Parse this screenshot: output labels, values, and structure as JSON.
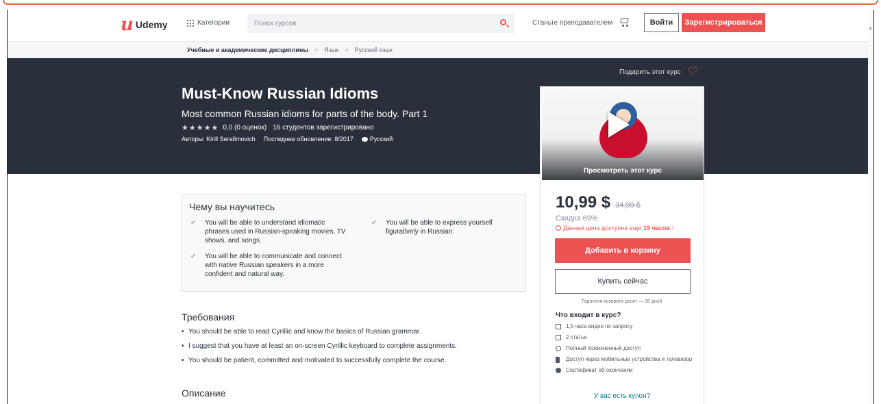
{
  "header": {
    "logo_text": "Udemy",
    "categories_label": "Категории",
    "search_placeholder": "Поиск курсов",
    "teach_label": "Станьте преподавателем",
    "login_label": "Войти",
    "signup_label": "Зарегистрироваться"
  },
  "breadcrumb": {
    "items": [
      "Учебные и академические дисциплины",
      "Язык",
      "Русский язык"
    ],
    "separator": ">"
  },
  "hero": {
    "gift_label": "Подарить этот курс",
    "title": "Must-Know Russian Idioms",
    "subtitle": "Most common Russian idioms for parts of the body. Part 1",
    "stars": "★★★★★",
    "rating_text": "0,0 (0 оценок)",
    "students_text": "16 студентов зарегистрировано",
    "authors_text": "Авторы: Kirill Serafimovich",
    "updated_text": "Последнее обновление: 8/2017",
    "language": "Русский"
  },
  "sidebar": {
    "preview_label": "Просмотреть этот курс",
    "price_now": "10,99 $",
    "price_old": "34,99 $",
    "discount": "Скидка 69%",
    "timer_prefix": "Данная цена доступна еще",
    "timer_value": "19 часов",
    "timer_suffix": "!",
    "add_to_cart_label": "Добавить в корзину",
    "buy_now_label": "Купить сейчас",
    "guarantee": "Гарантия возврата денег — 30 дней",
    "includes_title": "Что входит в курс?",
    "includes": [
      "1,5 часа видео по запросу",
      "2 статьи",
      "Полный пожизненный доступ",
      "Доступ через мобильные устройства и телевизор",
      "Сертификат об окончании"
    ],
    "coupon_label": "У вас есть купон?"
  },
  "learn": {
    "title": "Чему вы научитесь",
    "items": [
      "You will be able to understand idiomatic phrases used in Russian-speaking movies, TV shows, and songs.",
      "You will be able to express yourself figuratively in Russian.",
      "You will be able to communicate and connect with native Russian speakers in a more confident and natural way."
    ]
  },
  "requirements": {
    "title": "Требования",
    "items": [
      "You should be able to read Cyrillic and know the basics of Russian grammar.",
      "I suggest that you have at least an on-screen Cyrillic keyboard to complete assignments.",
      "You should be patient, committed and motivated to successfully complete the course."
    ]
  },
  "description": {
    "title": "Описание"
  },
  "colors": {
    "accent": "#ec5252",
    "dark": "#29303b",
    "link": "#007791"
  }
}
